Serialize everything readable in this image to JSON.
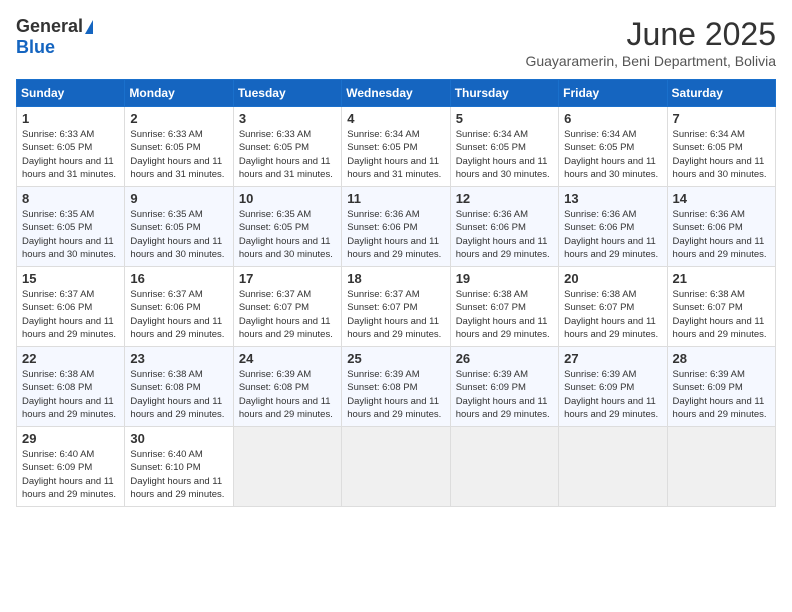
{
  "logo": {
    "general": "General",
    "blue": "Blue"
  },
  "title": "June 2025",
  "subtitle": "Guayaramerin, Beni Department, Bolivia",
  "headers": [
    "Sunday",
    "Monday",
    "Tuesday",
    "Wednesday",
    "Thursday",
    "Friday",
    "Saturday"
  ],
  "weeks": [
    [
      {
        "day": "1",
        "sunrise": "6:33 AM",
        "sunset": "6:05 PM",
        "daylight": "11 hours and 31 minutes."
      },
      {
        "day": "2",
        "sunrise": "6:33 AM",
        "sunset": "6:05 PM",
        "daylight": "11 hours and 31 minutes."
      },
      {
        "day": "3",
        "sunrise": "6:33 AM",
        "sunset": "6:05 PM",
        "daylight": "11 hours and 31 minutes."
      },
      {
        "day": "4",
        "sunrise": "6:34 AM",
        "sunset": "6:05 PM",
        "daylight": "11 hours and 31 minutes."
      },
      {
        "day": "5",
        "sunrise": "6:34 AM",
        "sunset": "6:05 PM",
        "daylight": "11 hours and 30 minutes."
      },
      {
        "day": "6",
        "sunrise": "6:34 AM",
        "sunset": "6:05 PM",
        "daylight": "11 hours and 30 minutes."
      },
      {
        "day": "7",
        "sunrise": "6:34 AM",
        "sunset": "6:05 PM",
        "daylight": "11 hours and 30 minutes."
      }
    ],
    [
      {
        "day": "8",
        "sunrise": "6:35 AM",
        "sunset": "6:05 PM",
        "daylight": "11 hours and 30 minutes."
      },
      {
        "day": "9",
        "sunrise": "6:35 AM",
        "sunset": "6:05 PM",
        "daylight": "11 hours and 30 minutes."
      },
      {
        "day": "10",
        "sunrise": "6:35 AM",
        "sunset": "6:05 PM",
        "daylight": "11 hours and 30 minutes."
      },
      {
        "day": "11",
        "sunrise": "6:36 AM",
        "sunset": "6:06 PM",
        "daylight": "11 hours and 29 minutes."
      },
      {
        "day": "12",
        "sunrise": "6:36 AM",
        "sunset": "6:06 PM",
        "daylight": "11 hours and 29 minutes."
      },
      {
        "day": "13",
        "sunrise": "6:36 AM",
        "sunset": "6:06 PM",
        "daylight": "11 hours and 29 minutes."
      },
      {
        "day": "14",
        "sunrise": "6:36 AM",
        "sunset": "6:06 PM",
        "daylight": "11 hours and 29 minutes."
      }
    ],
    [
      {
        "day": "15",
        "sunrise": "6:37 AM",
        "sunset": "6:06 PM",
        "daylight": "11 hours and 29 minutes."
      },
      {
        "day": "16",
        "sunrise": "6:37 AM",
        "sunset": "6:06 PM",
        "daylight": "11 hours and 29 minutes."
      },
      {
        "day": "17",
        "sunrise": "6:37 AM",
        "sunset": "6:07 PM",
        "daylight": "11 hours and 29 minutes."
      },
      {
        "day": "18",
        "sunrise": "6:37 AM",
        "sunset": "6:07 PM",
        "daylight": "11 hours and 29 minutes."
      },
      {
        "day": "19",
        "sunrise": "6:38 AM",
        "sunset": "6:07 PM",
        "daylight": "11 hours and 29 minutes."
      },
      {
        "day": "20",
        "sunrise": "6:38 AM",
        "sunset": "6:07 PM",
        "daylight": "11 hours and 29 minutes."
      },
      {
        "day": "21",
        "sunrise": "6:38 AM",
        "sunset": "6:07 PM",
        "daylight": "11 hours and 29 minutes."
      }
    ],
    [
      {
        "day": "22",
        "sunrise": "6:38 AM",
        "sunset": "6:08 PM",
        "daylight": "11 hours and 29 minutes."
      },
      {
        "day": "23",
        "sunrise": "6:38 AM",
        "sunset": "6:08 PM",
        "daylight": "11 hours and 29 minutes."
      },
      {
        "day": "24",
        "sunrise": "6:39 AM",
        "sunset": "6:08 PM",
        "daylight": "11 hours and 29 minutes."
      },
      {
        "day": "25",
        "sunrise": "6:39 AM",
        "sunset": "6:08 PM",
        "daylight": "11 hours and 29 minutes."
      },
      {
        "day": "26",
        "sunrise": "6:39 AM",
        "sunset": "6:09 PM",
        "daylight": "11 hours and 29 minutes."
      },
      {
        "day": "27",
        "sunrise": "6:39 AM",
        "sunset": "6:09 PM",
        "daylight": "11 hours and 29 minutes."
      },
      {
        "day": "28",
        "sunrise": "6:39 AM",
        "sunset": "6:09 PM",
        "daylight": "11 hours and 29 minutes."
      }
    ],
    [
      {
        "day": "29",
        "sunrise": "6:40 AM",
        "sunset": "6:09 PM",
        "daylight": "11 hours and 29 minutes."
      },
      {
        "day": "30",
        "sunrise": "6:40 AM",
        "sunset": "6:10 PM",
        "daylight": "11 hours and 29 minutes."
      },
      null,
      null,
      null,
      null,
      null
    ]
  ]
}
